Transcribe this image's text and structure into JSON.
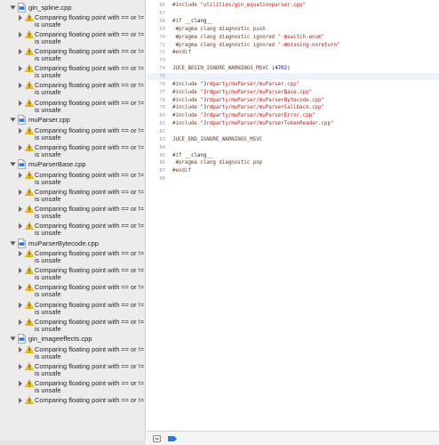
{
  "issues_navigator": {
    "groups": [
      {
        "file": "gin_spline.cpp",
        "issues": [
          {
            "line1": "Comparing floating point with == or !=",
            "line2": "is unsafe"
          },
          {
            "line1": "Comparing floating point with == or !=",
            "line2": "is unsafe"
          },
          {
            "line1": "Comparing floating point with == or !=",
            "line2": "is unsafe"
          },
          {
            "line1": "Comparing floating point with == or !=",
            "line2": "is unsafe"
          },
          {
            "line1": "Comparing floating point with == or !=",
            "line2": "is unsafe"
          },
          {
            "line1": "Comparing floating point with == or !=",
            "line2": "is unsafe"
          }
        ]
      },
      {
        "file": "muParser.cpp",
        "issues": [
          {
            "line1": "Comparing floating point with == or !=",
            "line2": "is unsafe"
          },
          {
            "line1": "Comparing floating point with == or !=",
            "line2": "is unsafe"
          }
        ]
      },
      {
        "file": "muParserBase.cpp",
        "issues": [
          {
            "line1": "Comparing floating point with == or !=",
            "line2": "is unsafe"
          },
          {
            "line1": "Comparing floating point with == or !=",
            "line2": "is unsafe"
          },
          {
            "line1": "Comparing floating point with == or !=",
            "line2": "is unsafe"
          },
          {
            "line1": "Comparing floating point with == or !=",
            "line2": "is unsafe"
          }
        ]
      },
      {
        "file": "muParserBytecode.cpp",
        "issues": [
          {
            "line1": "Comparing floating point with == or !=",
            "line2": "is unsafe"
          },
          {
            "line1": "Comparing floating point with == or !=",
            "line2": "is unsafe"
          },
          {
            "line1": "Comparing floating point with == or !=",
            "line2": "is unsafe"
          },
          {
            "line1": "Comparing floating point with == or !=",
            "line2": "is unsafe"
          },
          {
            "line1": "Comparing floating point with == or !=",
            "line2": "is unsafe"
          }
        ]
      },
      {
        "file": "gin_imageeffects.cpp",
        "issues": [
          {
            "line1": "Comparing floating point with == or !=",
            "line2": "is unsafe"
          },
          {
            "line1": "Comparing floating point with == or !=",
            "line2": "is unsafe"
          },
          {
            "line1": "Comparing floating point with == or !=",
            "line2": "is unsafe"
          },
          {
            "line1": "Comparing floating point with == or !="
          }
        ]
      }
    ]
  },
  "editor": {
    "current_line": "75",
    "lines": [
      {
        "n": "66",
        "parts": [
          {
            "t": "#include ",
            "c": "kw"
          },
          {
            "t": "\"utilities/gin_equationparser.cpp\"",
            "c": "str"
          }
        ]
      },
      {
        "n": "67",
        "parts": []
      },
      {
        "n": "68",
        "parts": [
          {
            "t": "#if ",
            "c": "kw"
          },
          {
            "t": "__clang__",
            "c": ""
          }
        ]
      },
      {
        "n": "69",
        "parts": [
          {
            "t": " #pragma clang diagnostic push",
            "c": "mac"
          }
        ]
      },
      {
        "n": "70",
        "parts": [
          {
            "t": " #pragma clang diagnostic ignored ",
            "c": "mac"
          },
          {
            "t": "\"-Wswitch-enum\"",
            "c": "str"
          }
        ]
      },
      {
        "n": "71",
        "parts": [
          {
            "t": " #pragma clang diagnostic ignored ",
            "c": "mac"
          },
          {
            "t": "\"-Wmissing-noreturn\"",
            "c": "str"
          }
        ]
      },
      {
        "n": "72",
        "parts": [
          {
            "t": "#endif",
            "c": "kw"
          }
        ]
      },
      {
        "n": "73",
        "parts": []
      },
      {
        "n": "74",
        "parts": [
          {
            "t": "JUCE_BEGIN_IGNORE_WARNINGS_MSVC",
            "c": "mac"
          },
          {
            "t": " (",
            "c": ""
          },
          {
            "t": "4702",
            "c": "num"
          },
          {
            "t": ")",
            "c": ""
          }
        ]
      },
      {
        "n": "75",
        "parts": []
      },
      {
        "n": "76",
        "parts": [
          {
            "t": "#include ",
            "c": "kw"
          },
          {
            "t": "\"3rdparty/muParser/muParser.cpp\"",
            "c": "str"
          }
        ]
      },
      {
        "n": "77",
        "parts": [
          {
            "t": "#include ",
            "c": "kw"
          },
          {
            "t": "\"3rdparty/muParser/muParserBase.cpp\"",
            "c": "str"
          }
        ]
      },
      {
        "n": "78",
        "parts": [
          {
            "t": "#include ",
            "c": "kw"
          },
          {
            "t": "\"3rdparty/muParser/muParserBytecode.cpp\"",
            "c": "str"
          }
        ]
      },
      {
        "n": "79",
        "parts": [
          {
            "t": "#include ",
            "c": "kw"
          },
          {
            "t": "\"3rdparty/muParser/muParserCallback.cpp\"",
            "c": "str"
          }
        ]
      },
      {
        "n": "80",
        "parts": [
          {
            "t": "#include ",
            "c": "kw"
          },
          {
            "t": "\"3rdparty/muParser/muParserError.cpp\"",
            "c": "str"
          }
        ]
      },
      {
        "n": "81",
        "parts": [
          {
            "t": "#include ",
            "c": "kw"
          },
          {
            "t": "\"3rdparty/muParser/muParserTokenReader.cpp\"",
            "c": "str"
          }
        ]
      },
      {
        "n": "82",
        "parts": []
      },
      {
        "n": "83",
        "parts": [
          {
            "t": "JUCE_END_IGNORE_WARNINGS_MSVC",
            "c": "mac"
          }
        ]
      },
      {
        "n": "84",
        "parts": []
      },
      {
        "n": "85",
        "parts": [
          {
            "t": "#if ",
            "c": "kw"
          },
          {
            "t": "__clang__",
            "c": ""
          }
        ]
      },
      {
        "n": "86",
        "parts": [
          {
            "t": " #pragma clang diagnostic pop",
            "c": "mac"
          }
        ]
      },
      {
        "n": "87",
        "parts": [
          {
            "t": "#endif",
            "c": "kw"
          }
        ]
      },
      {
        "n": "88",
        "parts": []
      }
    ]
  },
  "icons": {
    "warning": "warning-triangle-icon",
    "file": "cpp-file-icon",
    "filter": "filter-icon",
    "breakpoint": "breakpoint-icon"
  },
  "colors": {
    "warning_fill": "#f5c518",
    "breakpoint_blue": "#2a7ae2",
    "sidebar_bg": "#ececec"
  }
}
